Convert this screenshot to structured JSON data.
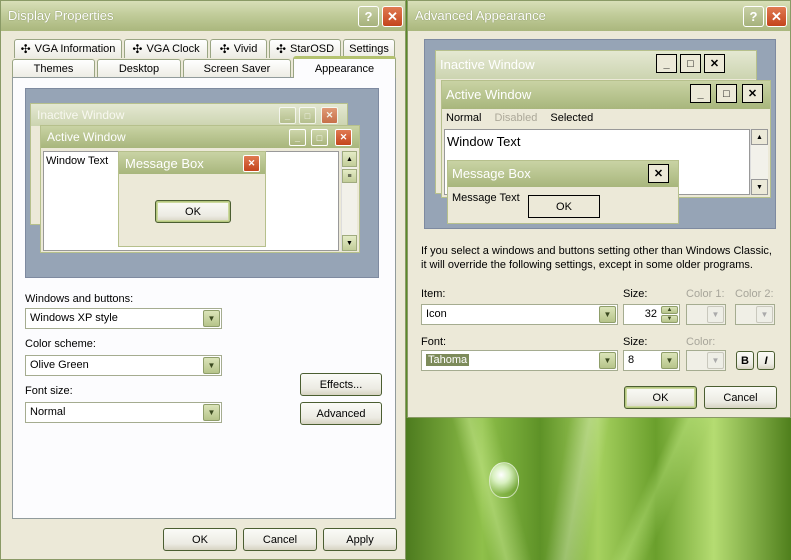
{
  "display_properties": {
    "title": "Display Properties",
    "tabs_row1": [
      "VGA Information",
      "VGA Clock",
      "Vivid",
      "StarOSD",
      "Settings"
    ],
    "tabs_row2": [
      "Themes",
      "Desktop",
      "Screen Saver",
      "Appearance"
    ],
    "active_tab": "Appearance",
    "preview": {
      "inactive_title": "Inactive Window",
      "active_title": "Active Window",
      "window_text": "Window Text",
      "msgbox_title": "Message Box",
      "ok": "OK"
    },
    "windows_buttons_label": "Windows and buttons:",
    "windows_buttons_value": "Windows XP style",
    "color_scheme_label": "Color scheme:",
    "color_scheme_value": "Olive Green",
    "font_size_label": "Font size:",
    "font_size_value": "Normal",
    "effects_button": "Effects...",
    "advanced_button": "Advanced",
    "ok_button": "OK",
    "cancel_button": "Cancel",
    "apply_button": "Apply"
  },
  "advanced_appearance": {
    "title": "Advanced Appearance",
    "preview": {
      "inactive_title": "Inactive Window",
      "active_title": "Active Window",
      "menu_normal": "Normal",
      "menu_disabled": "Disabled",
      "menu_selected": "Selected",
      "window_text": "Window Text",
      "msgbox_title": "Message Box",
      "msgbox_text": "Message Text",
      "ok": "OK"
    },
    "info_line1": "If you select a windows and buttons setting other than Windows Classic,",
    "info_line2": "it will override the following settings, except in some older programs.",
    "item_label": "Item:",
    "item_value": "Icon",
    "size_label": "Size:",
    "size_value": "32",
    "color1_label": "Color 1:",
    "color2_label": "Color 2:",
    "font_label": "Font:",
    "font_value": "Tahoma",
    "font_size_label": "Size:",
    "font_size_value": "8",
    "color_label": "Color:",
    "bold_button": "B",
    "italic_button": "I",
    "ok_button": "OK",
    "cancel_button": "Cancel"
  },
  "colors": {
    "titlebar": "#aab77d",
    "dialog_bg": "#ece9d8",
    "preview_bg": "#96a4b6",
    "close_red": "#c4441c"
  }
}
